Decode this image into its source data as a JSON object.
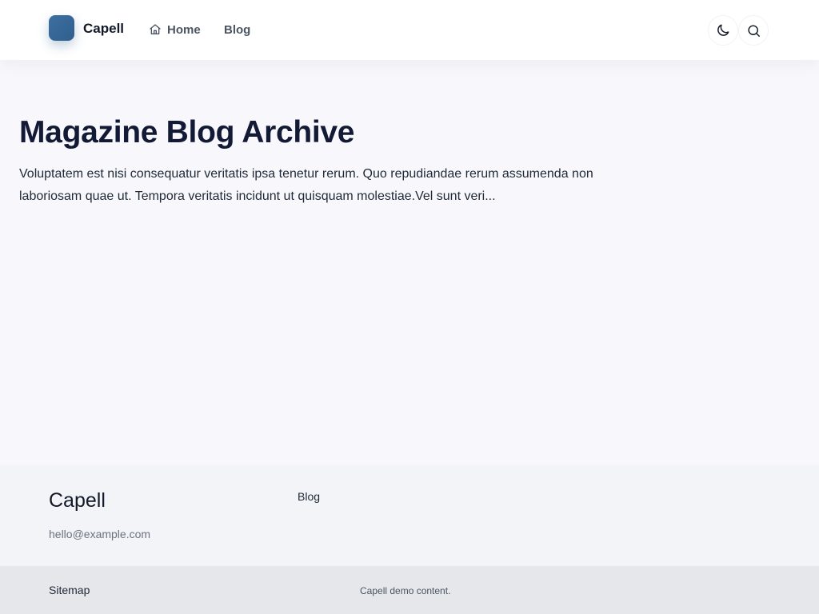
{
  "header": {
    "brand": "Capell",
    "nav": [
      {
        "label": "Home",
        "icon": "home-icon"
      },
      {
        "label": "Blog"
      }
    ],
    "actions": [
      {
        "icon": "moon-icon",
        "label": "toggle theme"
      },
      {
        "icon": "search-icon",
        "label": "search"
      }
    ]
  },
  "hero": {
    "title": "Magazine Blog Archive",
    "description": "Voluptatem est nisi consequatur veritatis ipsa tenetur rerum. Quo repudiandae rerum assumenda non laboriosam quae ut. Tempora veritatis incidunt ut quisquam molestiae.Vel sunt veri..."
  },
  "footer": {
    "brand": "Capell",
    "email": "hello@example.com",
    "links": [
      "Blog"
    ],
    "bottom": {
      "sitemap": "Sitemap",
      "copyright": "Capell demo content."
    }
  },
  "colors": {
    "brand_accent": "#3d6fa1",
    "page_bg": "#f8f8fc",
    "footer_bg": "#f3f4f7",
    "bottom_bar_bg": "#e5e7eb"
  }
}
